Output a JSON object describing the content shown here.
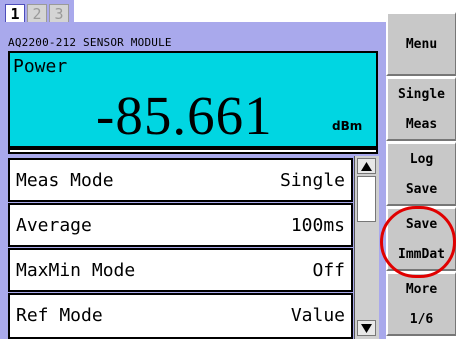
{
  "tabs": [
    "1",
    "2",
    "3"
  ],
  "module": {
    "title": "AQ2200-212 SENSOR MODULE"
  },
  "power": {
    "label": "Power",
    "value": "-85.661",
    "unit": "dBm"
  },
  "settings": [
    {
      "label": "Meas Mode",
      "value": "Single"
    },
    {
      "label": "Average",
      "value": "100ms"
    },
    {
      "label": "MaxMin Mode",
      "value": "Off"
    },
    {
      "label": "Ref Mode",
      "value": "Value"
    }
  ],
  "softkeys": [
    {
      "line1": "Menu",
      "line2": ""
    },
    {
      "line1": "Single",
      "line2": "Meas"
    },
    {
      "line1": "Log",
      "line2": "Save"
    },
    {
      "line1": "Save",
      "line2": "ImmDat"
    },
    {
      "line1": "More",
      "line2": "1/6"
    }
  ],
  "colors": {
    "panel": "#a9a9ec",
    "power_display": "#00d6e2",
    "softkey": "#c8c8c8",
    "highlight": "#e00000"
  },
  "icons": {
    "scroll_up": "triangle-up-icon",
    "scroll_down": "triangle-down-icon"
  }
}
